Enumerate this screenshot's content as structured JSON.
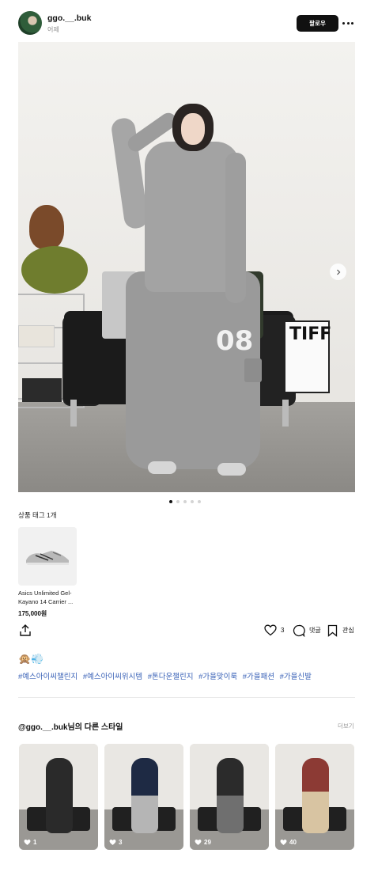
{
  "header": {
    "username": "ggo.__.buk",
    "timestamp": "어제",
    "follow_label": "팔로우"
  },
  "photo": {
    "pants_number": "08",
    "poster_text": "TIFF"
  },
  "carousel": {
    "current": 1,
    "total": 5
  },
  "product_tags": {
    "title": "상품 태그 1개",
    "items": [
      {
        "name": "Asics Unlimited Gel-Kayano 14 Carrier ...",
        "price": "175,000원"
      }
    ]
  },
  "actions": {
    "like_count": "3",
    "comment_label": "댓글",
    "save_label": "관심"
  },
  "caption": {
    "emoji": "🙊💨",
    "hashtags": [
      "#예스아이씨챌린지",
      "#예스아이씨위시템",
      "#톤다운챌린지",
      "#가을맞이룩",
      "#가을패션",
      "#가을신발"
    ]
  },
  "other_styles": {
    "title": "@ggo.__.buk님의 다른 스타일",
    "see_more": "더보기",
    "cards": [
      {
        "likes": "1",
        "color": "#2a2a2a"
      },
      {
        "likes": "3",
        "color": "#1e2a44"
      },
      {
        "likes": "29",
        "color": "#2b2b2b"
      },
      {
        "likes": "40",
        "color": "#8c3a34"
      }
    ]
  },
  "colors": {
    "hashtag": "#3a62b7",
    "follow_button": "#111111"
  }
}
